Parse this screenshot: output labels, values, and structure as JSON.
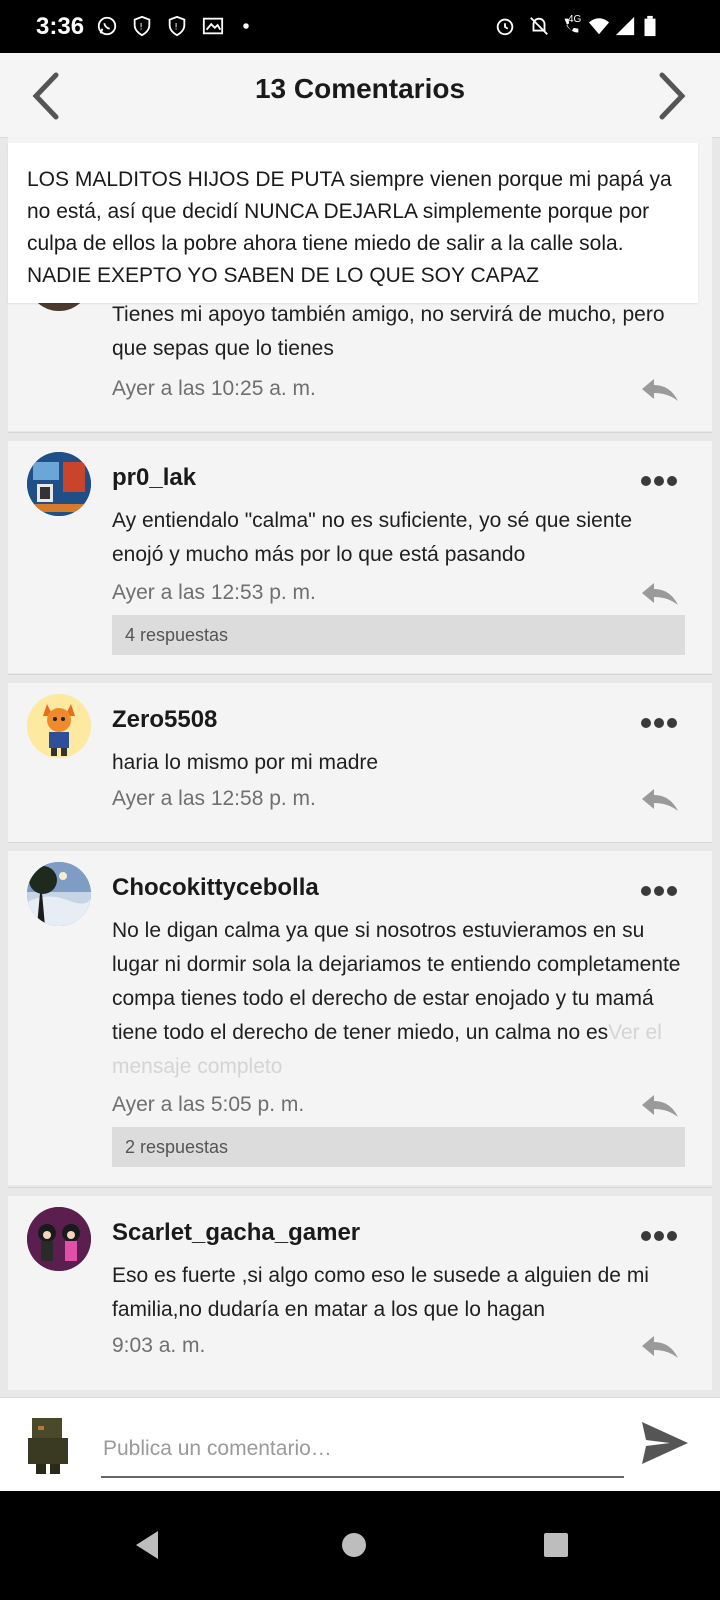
{
  "status_bar": {
    "time": "3:36",
    "network": "4G"
  },
  "header": {
    "title": "13 Comentarios"
  },
  "pinned_post": {
    "text": "LOS MALDITOS HIJOS DE PUTA siempre vienen porque mi papá ya no está, así que decidí NUNCA DEJARLA simplemente porque por culpa de ellos la pobre ahora tiene miedo de salir a la calle sola. NADIE EXEPTO YO SABEN DE LO QUE SOY CAPAZ"
  },
  "comments": [
    {
      "author": "",
      "body": "Tienes mi apoyo también amigo, no servirá de mucho, pero que sepas que lo tienes",
      "timestamp": "Ayer a las 10:25 a. m."
    },
    {
      "author": "pr0_lak",
      "body": "Ay entiendalo \"calma\" no es suficiente, yo sé que siente enojó y mucho más por lo que está pasando",
      "timestamp": "Ayer a las 12:53 p. m.",
      "replies": "4 respuestas"
    },
    {
      "author": "Zero5508",
      "body": "haria lo mismo por mi madre",
      "timestamp": "Ayer a las 12:58 p. m."
    },
    {
      "author": "Chocokittycebolla",
      "body": "No le digan calma ya que si nosotros estuvieramos en su lugar ni dormir sola la dejariamos te entiendo completamente compa tienes todo el derecho de estar enojado y tu mamá tiene todo el derecho de tener miedo, un calma no es",
      "more": "Ver el mensaje completo",
      "timestamp": "Ayer a las 5:05 p. m.",
      "replies": "2 respuestas"
    },
    {
      "author": "Scarlet_gacha_gamer",
      "body": "Eso es fuerte ,si algo como eso le susede a alguien de mi familia,no dudaría en matar a los que lo hagan",
      "timestamp": "9:03 a. m."
    }
  ],
  "composer": {
    "placeholder": "Publica un comentario…"
  }
}
